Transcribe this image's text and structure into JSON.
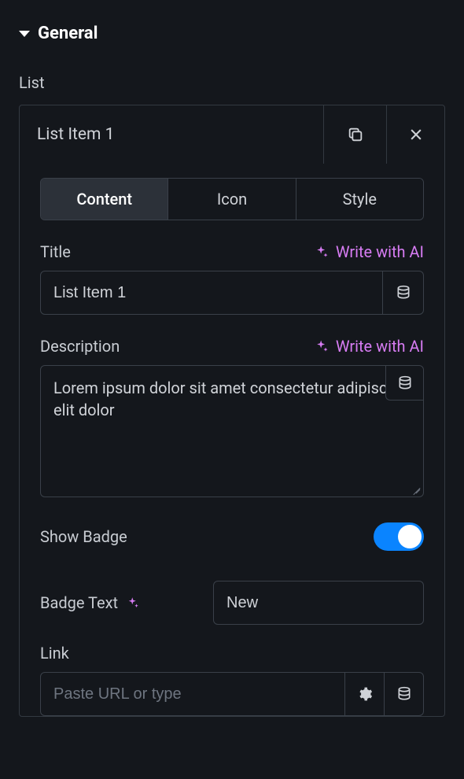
{
  "section": {
    "title": "General"
  },
  "list": {
    "label": "List",
    "item_title": "List Item 1"
  },
  "tabs": {
    "content": "Content",
    "icon": "Icon",
    "style": "Style"
  },
  "title_field": {
    "label": "Title",
    "ai_label": "Write with AI",
    "value": "List Item 1"
  },
  "description_field": {
    "label": "Description",
    "ai_label": "Write with AI",
    "value": "Lorem ipsum dolor sit amet consectetur adipiscing elit dolor"
  },
  "show_badge": {
    "label": "Show Badge",
    "value": true
  },
  "badge_text": {
    "label": "Badge Text",
    "value": "New"
  },
  "link": {
    "label": "Link",
    "placeholder": "Paste URL or type",
    "value": ""
  }
}
